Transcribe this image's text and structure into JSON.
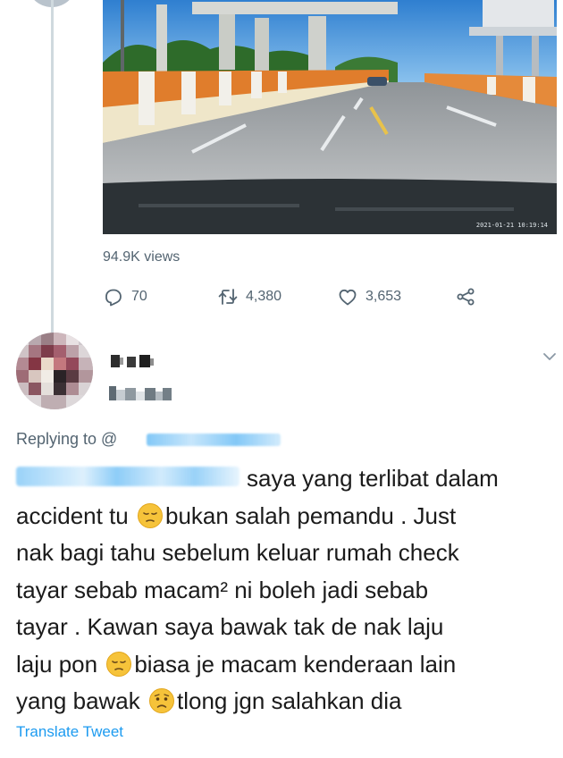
{
  "video": {
    "timestamp": "2021-01-21 10:19:14"
  },
  "stats": {
    "views": "94.9K views",
    "replies": "70",
    "retweets": "4,380",
    "likes": "3,653"
  },
  "reply": {
    "replying_to_label": "Replying to @",
    "text_lines": [
      "saya yang terlibat dalam",
      "accident tu ",
      "bukan salah pemandu . Just",
      "nak bagi tahu sebelum keluar rumah check",
      "tayar sebab macam² ni boleh jadi sebab",
      "tayar . Kawan saya bawak tak de nak laju",
      "laju pon ",
      "biasa je macam kenderaan lain",
      "yang bawak ",
      "tlong jgn salahkan dia"
    ],
    "translate_label": "Translate Tweet"
  },
  "icons": {
    "reply": "reply-bubble-icon",
    "retweet": "retweet-icon",
    "like": "heart-icon",
    "share": "share-icon",
    "more": "chevron-down-icon",
    "emoji_pensive": "pensive-face-emoji",
    "emoji_worried": "worried-face-emoji"
  },
  "colors": {
    "accent": "#1d9bf0",
    "secondary_text": "#536471",
    "thread_line": "#cfd9de"
  }
}
